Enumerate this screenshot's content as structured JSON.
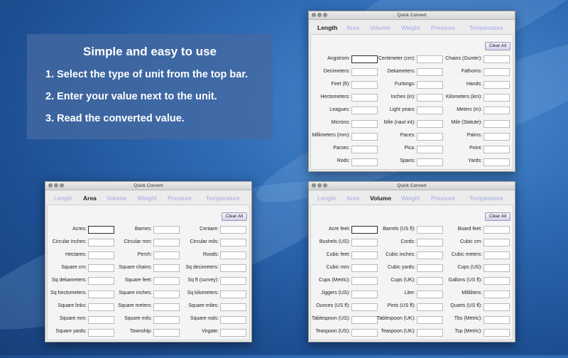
{
  "info": {
    "title": "Simple and easy to use",
    "steps": [
      "1.  Select the type of unit from the top bar.",
      "2.  Enter your value next to the unit.",
      "3.  Read the converted value."
    ]
  },
  "window_title": "Quick Convert",
  "clear_label": "Clear All",
  "tabs": [
    "Length",
    "Area",
    "Volume",
    "Weight",
    "Pressure",
    "Temperature"
  ],
  "windows": [
    {
      "active": 0,
      "labels": [
        "Angstrom:",
        "Centimeter (cm):",
        "Chains (Gunter):",
        "Decimeters:",
        "Dekameters:",
        "Fathoms:",
        "Feet (ft):",
        "Furlongs:",
        "Hands:",
        "Hectometers:",
        "Inches (in):",
        "Kilometers (km):",
        "Leagues:",
        "Light years:",
        "Meters (m):",
        "Microns:",
        "Mile (naut int):",
        "Mile (Statute):",
        "Millimeters (mm):",
        "Paces:",
        "Palms:",
        "Parsec:",
        "Pica:",
        "Point:",
        "Rods:",
        "Spans:",
        "Yards:"
      ]
    },
    {
      "active": 1,
      "labels": [
        "Acres:",
        "Barnes:",
        "Centare:",
        "Circular inches:",
        "Circular mm:",
        "Circular mils:",
        "Hectares:",
        "Perch:",
        "Roods:",
        "Square cm:",
        "Square chains:",
        "Sq decimeters:",
        "Sq dekameters:",
        "Square feet:",
        "Sq  ft (survey):",
        "Sq hectometers:",
        "Square inches:",
        "Sq kilometers:",
        "Square links:",
        "Square meters:",
        "Square miles:",
        "Square mm:",
        "Square mils:",
        "Square rods:",
        "Square yards:",
        "Township:",
        "Virgate:"
      ]
    },
    {
      "active": 2,
      "labels": [
        "Acre feet:",
        "Barrels (US fl):",
        "Board feet:",
        "Bushels (US):",
        "Cords:",
        "Cubic cm:",
        "Cubic feet:",
        "Cubic inches:",
        "Cubic meters:",
        "Cubic mm:",
        "Cubic yards:",
        "Cups (US):",
        "Cups (Metric):",
        "Cups (UK):",
        "Gallons (US fl):",
        "Jiggers (US):",
        "Liter:",
        "Milliliters:",
        "Ounces (US fl):",
        "Pints (US fl):",
        "Quarts (US fl):",
        "Tablespoon (US):",
        "Tablespoon (UK):",
        "Tbs (Metric):",
        "Teaspoon (US):",
        "Teaspoon (UK):",
        "Tsp (Metric):"
      ]
    }
  ]
}
